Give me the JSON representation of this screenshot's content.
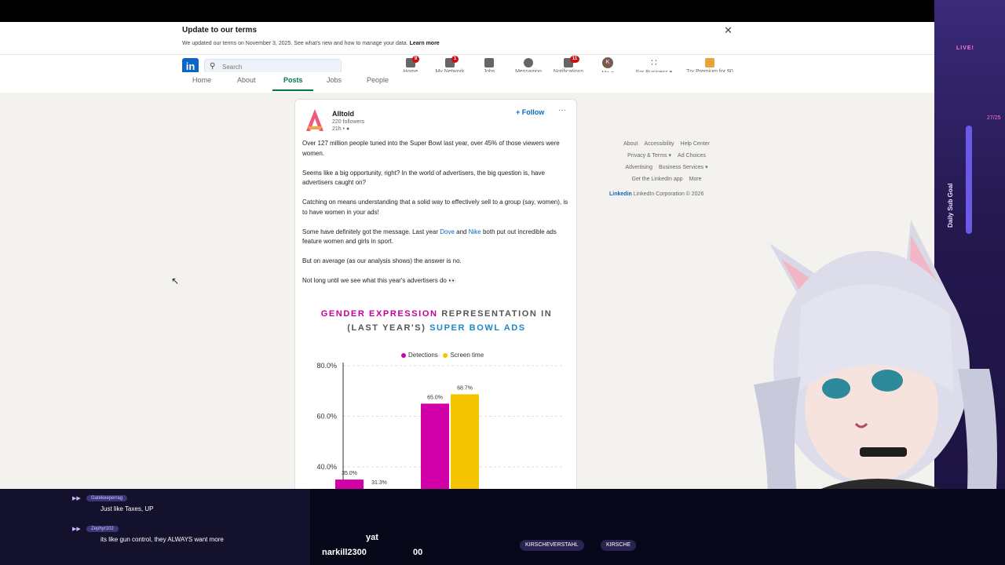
{
  "terms_banner": {
    "title": "Update to our terms",
    "text": "We updated our terms on November 3, 2025. See what's new and how to manage your data.",
    "link": "Learn more",
    "close": "✕"
  },
  "navbar": {
    "logo": "in",
    "search_placeholder": "Search",
    "items": [
      {
        "label": "Home",
        "badge": "9"
      },
      {
        "label": "My Network",
        "badge": "1"
      },
      {
        "label": "Jobs",
        "badge": ""
      },
      {
        "label": "Messaging",
        "badge": ""
      },
      {
        "label": "Notifications",
        "badge": "11"
      },
      {
        "label": "Me ▾",
        "avatar": "K"
      },
      {
        "label": "For Business ▾",
        "badge": ""
      },
      {
        "label": "Try Premium for $0",
        "badge": ""
      }
    ]
  },
  "subnav": {
    "tabs": [
      "Home",
      "About",
      "Posts",
      "Jobs",
      "People"
    ],
    "active": "Posts"
  },
  "post": {
    "author": "Alltold",
    "followers": "220 followers",
    "time": "21h • ",
    "follow_label": "+ Follow",
    "more": "···",
    "paragraphs": [
      "Over 127 million people tuned into the Super Bowl last year, over 45% of those viewers were women.",
      "Seems like a big opportunity, right? In the world of advertisers, the big question is, have advertisers caught on?",
      "Catching on means understanding that a solid way to effectively sell to a group (say, women), is to have women in your ads!",
      "But on average (as our analysis shows) the answer is no.",
      "Not long until we see what this year's advertisers do 👀"
    ],
    "para4": {
      "pre": "Some have definitely got the message. Last year ",
      "link1": "Dove",
      "mid": " and ",
      "link2": "Nike",
      "post": " both put out incredible ads feature women and girls in sport."
    }
  },
  "chart_data": {
    "type": "bar",
    "title_part1": "GENDER EXPRESSION",
    "title_part2": " REPRESENTATION IN",
    "title_part3": "(LAST YEAR'S) ",
    "title_part4": "SUPER BOWL ADS",
    "series": [
      {
        "name": "Detections",
        "color": "#d100a8",
        "values": [
          35.0,
          65.0
        ]
      },
      {
        "name": "Screen time",
        "color": "#f5c400",
        "values": [
          31.3,
          68.7
        ]
      }
    ],
    "value_labels": [
      [
        "35.0%",
        "65.0%"
      ],
      [
        "31.3%",
        "68.7%"
      ]
    ],
    "y_ticks": [
      "80.0%",
      "60.0%",
      "40.0%"
    ],
    "y_tick_values": [
      80,
      60,
      40
    ],
    "ylim": [
      20,
      80
    ],
    "grid": true,
    "legend": "top"
  },
  "right_rail": {
    "links": [
      "About",
      "Accessibility",
      "Help Center",
      "Privacy & Terms ▾",
      "Ad Choices",
      "Advertising",
      "Business Services ▾",
      "Get the LinkedIn app",
      "More"
    ],
    "brand": "Linked",
    "brand_in": "in",
    "copyright": " LinkedIn Corporation © 2026"
  },
  "stream": {
    "live": "LIVE!",
    "goal_count": "27/25",
    "goal_label": "Daily Sub Goal",
    "chat": [
      {
        "user": "Gatekeeperrag",
        "msg": "Just like Taxes, UP"
      },
      {
        "user": "Zephyr102",
        "msg": "its like gun control, they ALWAYS want more"
      }
    ],
    "ticker1": "yat",
    "ticker2": "narkill2300",
    "ticker3": "00",
    "socials": [
      "KIRSCHEVERSTAHL",
      "KIRSCHE"
    ]
  }
}
